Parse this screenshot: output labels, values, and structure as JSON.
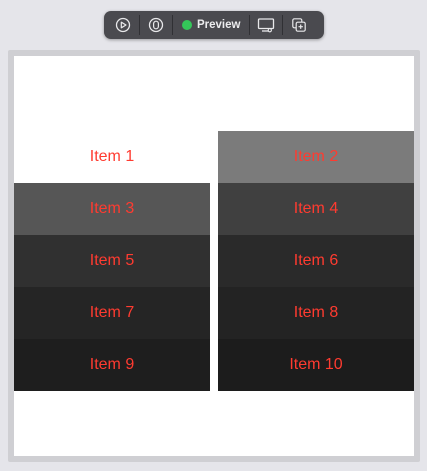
{
  "toolbar": {
    "live_icon": "play-circle-icon",
    "inspect_icon": "pin-icon",
    "preview_label": "Preview",
    "device_icon": "device-settings-icon",
    "duplicate_icon": "duplicate-preview-icon"
  },
  "colors": {
    "item_text": "#ff3b30",
    "status": "#34c759"
  },
  "items": [
    {
      "label": "Item 1",
      "background": "#ffffff"
    },
    {
      "label": "Item 2",
      "background": "#7b7b7b"
    },
    {
      "label": "Item 3",
      "background": "#565656"
    },
    {
      "label": "Item 4",
      "background": "#404040"
    },
    {
      "label": "Item 5",
      "background": "#303030"
    },
    {
      "label": "Item 6",
      "background": "#2a2a2a"
    },
    {
      "label": "Item 7",
      "background": "#252525"
    },
    {
      "label": "Item 8",
      "background": "#232323"
    },
    {
      "label": "Item 9",
      "background": "#1e1e1e"
    },
    {
      "label": "Item 10",
      "background": "#1c1c1c"
    }
  ]
}
